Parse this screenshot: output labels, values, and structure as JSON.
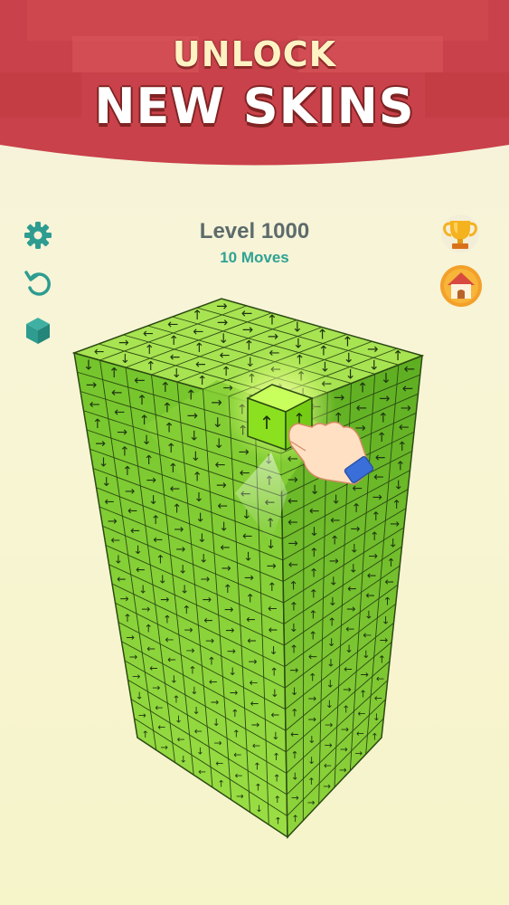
{
  "promo": {
    "line1": "UNLOCK",
    "line2": "NEW SKINS",
    "colors": {
      "banner_red": "#c9414a",
      "banner_light": "#db5a5e"
    }
  },
  "hud": {
    "level_title": "Level 1000",
    "moves": "10 Moves",
    "icons": {
      "settings": "gear-icon",
      "undo": "undo-icon",
      "skins": "cube-icon",
      "trophy": "trophy-icon",
      "home": "home-icon"
    }
  },
  "board": {
    "cube_color": "#8ed93b",
    "arrow_directions": [
      "up",
      "down",
      "left",
      "right"
    ],
    "selected_cube_arrow": "up",
    "tutorial_hint": "hand-pointer-icon"
  }
}
